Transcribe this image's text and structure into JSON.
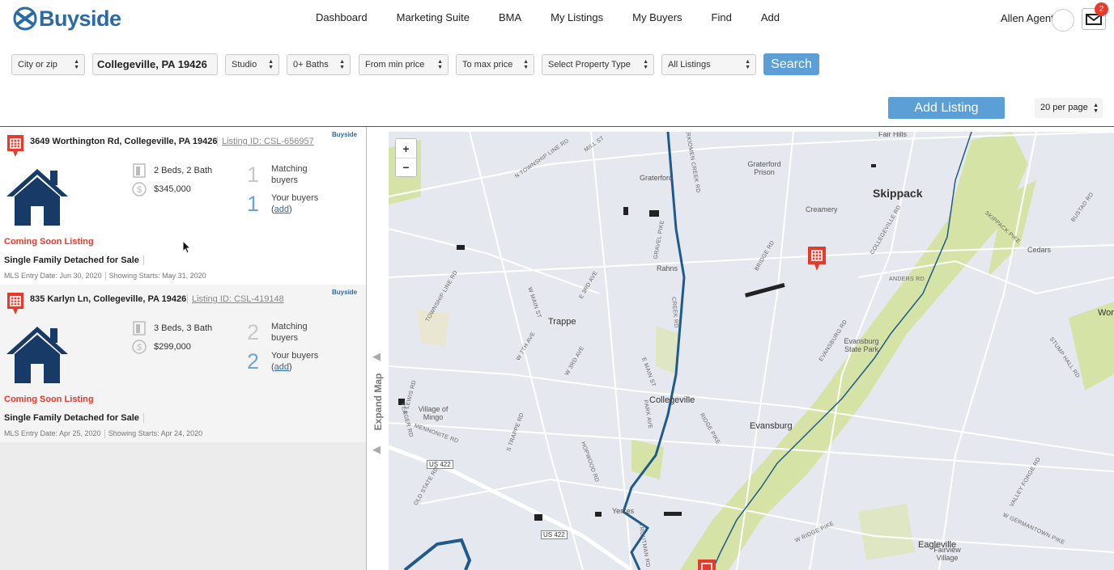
{
  "app": {
    "name": "Buyside"
  },
  "nav": [
    "Dashboard",
    "Marketing Suite",
    "BMA",
    "My Listings",
    "My Buyers",
    "Find",
    "Add"
  ],
  "user": {
    "name": "Allen Agent",
    "notifications": "2"
  },
  "filters": {
    "city_zip": "City or zip",
    "location": "Collegeville, PA 19426",
    "beds": "Studio",
    "baths": "0+ Baths",
    "min_price": "From min price",
    "max_price": "To max price",
    "property_type": "Select Property Type",
    "listings": "All Listings",
    "search_label": "Search"
  },
  "actions": {
    "add_listing": "Add Listing",
    "per_page": "20 per page"
  },
  "listings": [
    {
      "address": "3649 Worthington Rd, Collegeville, PA 19426",
      "listing_id": "Listing ID: CSL-656957",
      "beds_baths": "2 Beds, 2 Bath",
      "price": "$345,000",
      "matching_count": "1",
      "matching_label": "Matching buyers",
      "your_count": "1",
      "your_label": "Your buyers",
      "add_link": "add",
      "status": "Coming Soon Listing",
      "type": "Single Family Detached for Sale",
      "entry_date": "MLS Entry Date: Jun 30, 2020",
      "showing_date": "Showing Starts: May 31, 2020"
    },
    {
      "address": "835 Karlyn Ln, Collegeville, PA 19426",
      "listing_id": "Listing ID: CSL-419148",
      "beds_baths": "3 Beds, 3 Bath",
      "price": "$299,000",
      "matching_count": "2",
      "matching_label": "Matching buyers",
      "your_count": "2",
      "your_label": "Your buyers",
      "add_link": "add",
      "status": "Coming Soon Listing",
      "type": "Single Family Detached for Sale",
      "entry_date": "MLS Entry Date: Apr 25, 2020",
      "showing_date": "Showing Starts: Apr 24, 2020"
    }
  ],
  "map": {
    "expand_label": "Expand Map",
    "zoom_in": "+",
    "zoom_out": "−",
    "places": {
      "skippack": "Skippack",
      "trappe": "Trappe",
      "collegeville": "Collegeville",
      "evansburg": "Evansburg",
      "eagleville": "Eagleville",
      "graterford": "Graterford",
      "graterford_prison": "Graterford Prison",
      "rahns": "Rahns",
      "creamery": "Creamery",
      "cedars": "Cedars",
      "fair_hills": "Fair Hills",
      "village_of_mingo": "Village of Mingo",
      "yerkes": "Yerkes",
      "evansburg_state_park": "Evansburg State Park",
      "fairview_village": "Fairview Village",
      "wor": "Wor"
    },
    "roads": {
      "us422_a": "US 422",
      "us422_b": "US 422",
      "w_main_st": "W MAIN ST",
      "e_main_st": "E MAIN ST",
      "gravel_pike": "GRAVEL PIKE",
      "bridge_rd": "BRIDGE RD",
      "anders_rd": "ANDERS RD",
      "ridge_pike": "RIDGE PIKE",
      "w_ridge_pike": "W RIDGE PIKE",
      "skippack_pike": "SKIPPACK PIKE",
      "evansburg_rd": "EVANSBURG RD",
      "stump_hall_rd": "STUMP HALL RD",
      "collegeville_rd": "COLLEGEVILLE RD",
      "mennonite_rd": "MENNONITE RD",
      "w_germantown_pike": "W GERMANTOWN PIKE",
      "valley_forge_rd": "VALLEY FORGE RD",
      "township_line_rd": "TOWNSHIP LINE RD",
      "n_township_line_rd": "N TOWNSHIP LINE RD",
      "s_lewis_rd": "S LEWIS RD",
      "s_trappe_rd": "S TRAPPE RD",
      "hopwood_rd": "HOPWOOD RD",
      "park_ave": "PARK AVE",
      "troutman_rd": "TROUTMAN RD",
      "creek_rd": "CREEK RD",
      "busted_rd": "BUSTAD RD",
      "w_7th_ave": "W 7TH AVE",
      "w_3rd_ave": "W 3RD AVE",
      "e_3rd_ave": "E 3RD AVE",
      "perkiomen_creek_rd": "PERKIOMEN CREEK RD",
      "yeager_rd": "YEAGER RD",
      "old_state_rd": "OLD STATE RD",
      "mill_st": "MILL ST",
      "e_ridge_pike": "RIDGE PIKE",
      "s_ridge_pike": "RIDGE PIKE"
    }
  },
  "colors": {
    "accent": "#5b9fd6",
    "brand": "#2a6aa8",
    "alert": "#e53b2c",
    "park": "#d5e3a6",
    "water": "#1f5a8c"
  }
}
